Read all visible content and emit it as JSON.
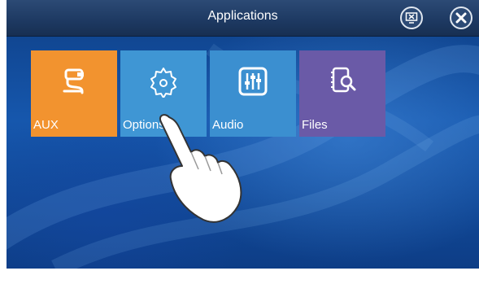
{
  "header": {
    "title": "Applications"
  },
  "tiles": [
    {
      "label": "AUX",
      "icon": "aux-cable-icon",
      "color": "#f2932f"
    },
    {
      "label": "Options",
      "icon": "gear-icon",
      "color": "#3f96d4"
    },
    {
      "label": "Audio",
      "icon": "equalizer-icon",
      "color": "#3b8fd0"
    },
    {
      "label": "Files",
      "icon": "file-search-icon",
      "color": "#6a5aa7"
    }
  ],
  "colors": {
    "title_bar": "#1e3a63",
    "background": "#1657ad"
  }
}
